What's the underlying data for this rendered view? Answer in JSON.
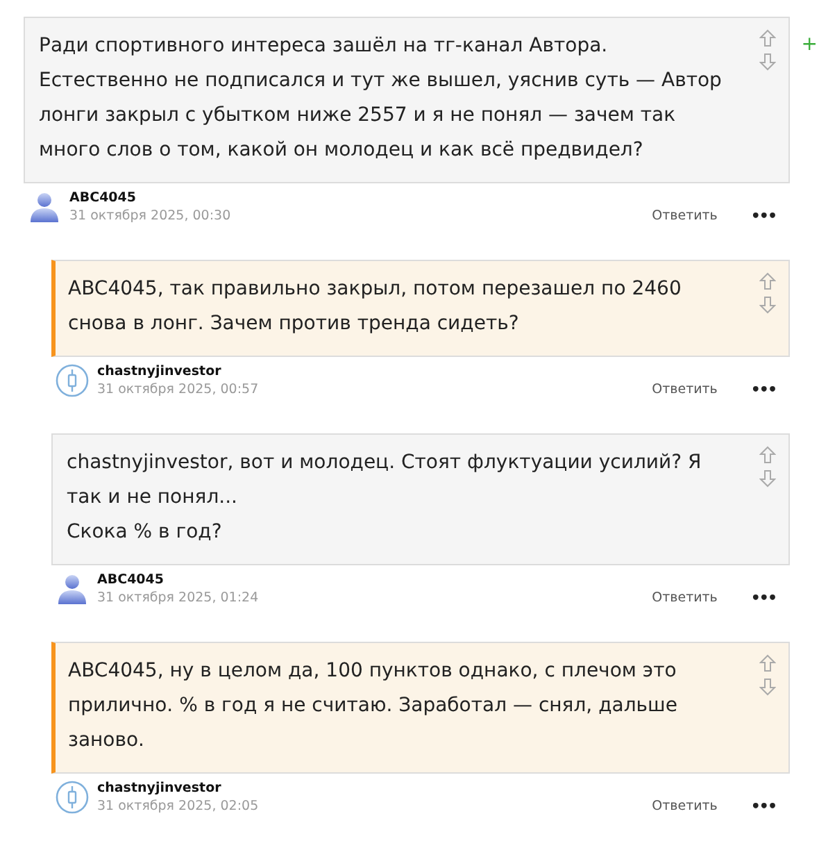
{
  "comments": [
    {
      "nested": false,
      "highlighted": false,
      "text": "Ради спортивного интереса зашёл на тг-канал Автора. Естественно не подписался и тут же вышел, уяснив суть — Автор лонги закрыл с убытком ниже 2557 и я не понял — зачем так много слов о том, какой он молодец и как всё предвидел?",
      "side_mark": "+",
      "author": "ABC4045",
      "date": "31 октября 2025, 00:30",
      "avatar": {
        "kind": "person"
      },
      "reply": "Ответить",
      "more": "•••"
    },
    {
      "nested": true,
      "highlighted": true,
      "text": "ABC4045, так правильно закрыл, потом перезашел по 2460 снова в лонг. Зачем против тренда сидеть?",
      "author": "chastnyjinvestor",
      "date": "31 октября 2025, 00:57",
      "avatar": {
        "kind": "logo"
      },
      "reply": "Ответить",
      "more": "•••"
    },
    {
      "nested": true,
      "highlighted": false,
      "text": "chastnyjinvestor, вот и молодец. Стоят флуктуации усилий? Я так и не понял...\nСкока % в год?",
      "author": "ABC4045",
      "date": "31 октября 2025, 01:24",
      "avatar": {
        "kind": "person"
      },
      "reply": "Ответить",
      "more": "•••"
    },
    {
      "nested": true,
      "highlighted": true,
      "text": "ABC4045, ну в целом да, 100 пунктов однако, с плечом это прилично. % в год я не считаю. Заработал — снял, дальше заново.",
      "author": "chastnyjinvestor",
      "date": "31 октября 2025, 02:05",
      "avatar": {
        "kind": "logo"
      },
      "reply": "Ответить",
      "more": "•••"
    }
  ]
}
